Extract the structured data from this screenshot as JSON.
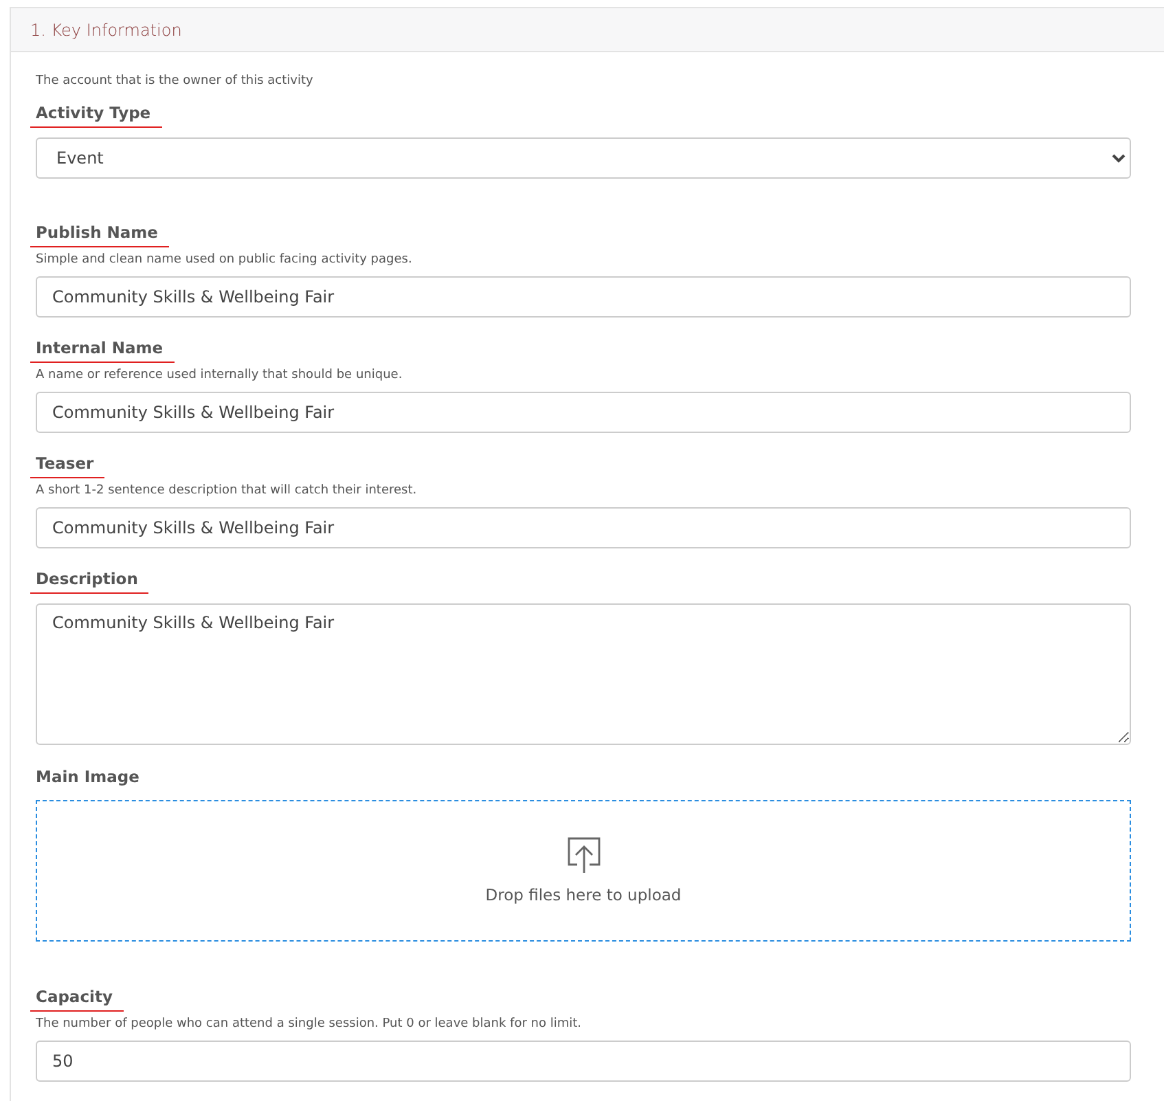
{
  "panel": {
    "title": "1. Key Information",
    "intro": "The account that is the owner of this activity",
    "fields": [
      {
        "kind": "select",
        "label": "Activity Type",
        "underlined": true,
        "value": "Event"
      },
      {
        "kind": "text",
        "label": "Publish Name",
        "underlined": true,
        "help": "Simple and clean name used on public facing activity pages.",
        "value": "Community Skills & Wellbeing Fair"
      },
      {
        "kind": "text",
        "label": "Internal Name",
        "underlined": true,
        "help": "A name or reference used internally that should be unique.",
        "value": "Community Skills & Wellbeing Fair"
      },
      {
        "kind": "text",
        "label": "Teaser",
        "underlined": true,
        "help": "A short 1-2 sentence description that will catch their interest.",
        "value": "Community Skills & Wellbeing Fair"
      },
      {
        "kind": "textarea",
        "label": "Description",
        "underlined": true,
        "value": "Community Skills & Wellbeing Fair"
      },
      {
        "kind": "dropzone",
        "label": "Main Image",
        "underlined": false,
        "prompt": "Drop files here to upload"
      },
      {
        "kind": "text",
        "label": "Capacity",
        "underlined": true,
        "help": "The number of people who can attend a single session. Put 0 or leave blank for no limit.",
        "value": "50"
      }
    ]
  }
}
